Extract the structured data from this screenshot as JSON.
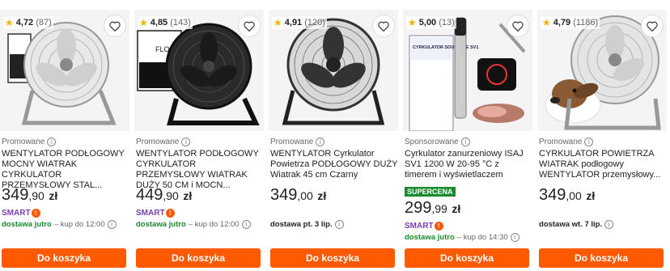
{
  "products": [
    {
      "rating": "4,72",
      "count": "(87)",
      "promo": "Promowane",
      "title": "WENTYLATOR PODŁOGOWY MOCNY WIATRAK CYRKULATOR PRZEMYSŁOWY STAL...",
      "price_int": "349",
      "price_cents": ",90",
      "currency": "zł",
      "smart": "SMART",
      "delivery_when": "dostawa jutro",
      "delivery_sub": "– kup do 12:00",
      "button": "Do koszyka",
      "image": "chrome-floor-fan"
    },
    {
      "rating": "4,85",
      "count": "(143)",
      "promo": "Promowane",
      "title": "WENTYLATOR PODŁOGOWY CYRKULATOR PRZEMYSŁOWY WIATRAK DUŻY 50 CM i MOCN...",
      "price_int": "449",
      "price_cents": ",90",
      "currency": "zł",
      "smart": "SMART",
      "delivery_when": "dostawa jutro",
      "delivery_sub": "– kup do 12:00",
      "button": "Do koszyka",
      "box_text": "FLOOR FAN",
      "image": "black-floor-fan"
    },
    {
      "rating": "4,91",
      "count": "(120)",
      "promo": "Promowane",
      "title": "WENTYLATOR Cyrkulator Powietrza PODŁOGOWY DUŻY Wiatrak 45 cm Czarny",
      "price_int": "349",
      "price_cents": ",00",
      "currency": "zł",
      "delivery_when": "dostawa pt. 3 lip.",
      "button": "Do koszyka",
      "image": "dark-floor-fan"
    },
    {
      "rating": "5,00",
      "count": "(13)",
      "promo": "Sponsorowane",
      "title": "Cyrkulator zanurzeniowy ISAJ SV1 1200 W 20-95 °C z timerem i wyświetlaczem",
      "badge": "SUPERCENA",
      "price_int": "299",
      "price_cents": ",99",
      "currency": "zł",
      "smart": "SMART",
      "delivery_when": "dostawa jutro",
      "delivery_sub": "– kup do 14:30",
      "button": "Do koszyka",
      "box_text": "CYRKULATOR SOUS VIDE SV1",
      "image": "sous-vide"
    },
    {
      "rating": "4,79",
      "count": "(1186)",
      "promo": "Promowane",
      "title": "CYRKULATOR POWIETRZA WIATRAK podłogowy WENTYLATOR przemysłowy...",
      "price_int": "349",
      "price_cents": ",00",
      "currency": "zł",
      "delivery_when": "dostawa wt. 7 lip.",
      "button": "Do koszyka",
      "image": "chrome-fan-dog"
    }
  ],
  "colors": {
    "accent": "#ff5a00",
    "green": "#1a8a2e",
    "smart": "#7b3fb0",
    "star": "#f4b400"
  }
}
